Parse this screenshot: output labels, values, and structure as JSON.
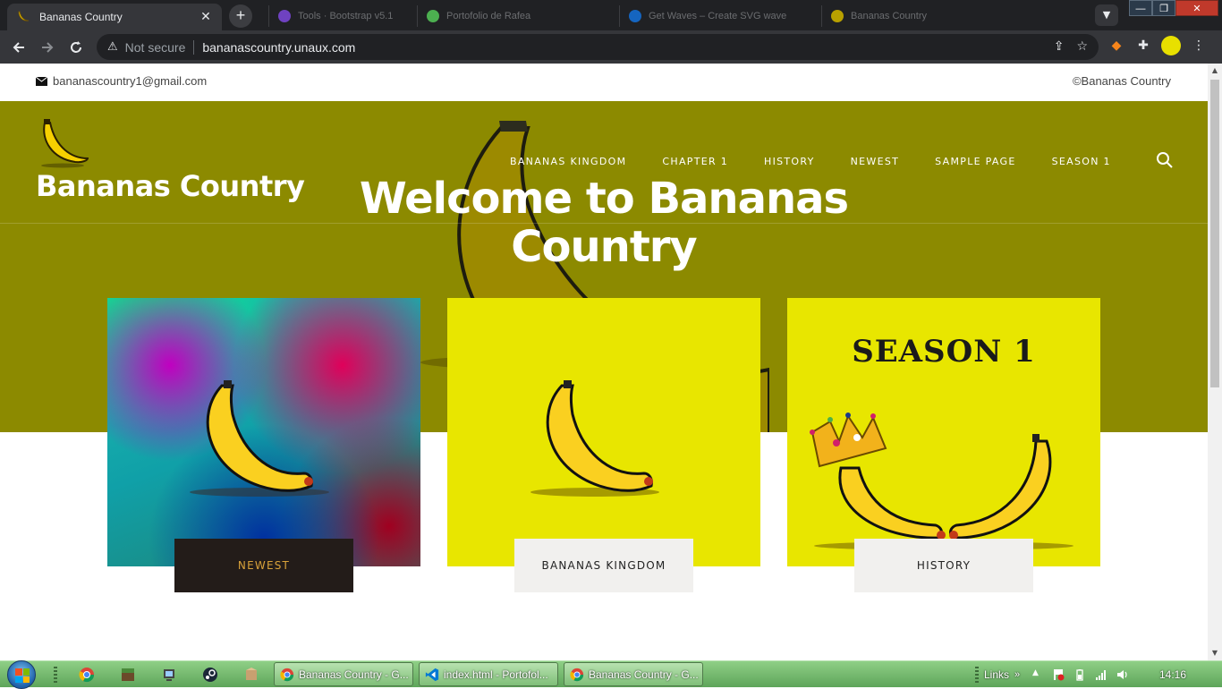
{
  "browser": {
    "active_tab_title": "Bananas Country",
    "background_tabs": [
      "Tools · Bootstrap v5.1",
      "Portofolio de Rafea",
      "Get Waves – Create SVG wave",
      "Bananas Country"
    ],
    "security_label": "Not secure",
    "url": "bananascountry.unaux.com"
  },
  "site": {
    "email": "bananascountry1@gmail.com",
    "copyright": "©Bananas Country",
    "title": "Bananas Country",
    "nav": [
      "BANANAS KINGDOM",
      "CHAPTER 1",
      "HISTORY",
      "NEWEST",
      "SAMPLE PAGE",
      "SEASON 1"
    ],
    "welcome": "Welcome to Bananas Country",
    "season_heading": "SEASON 1",
    "cards": [
      {
        "label": "NEWEST"
      },
      {
        "label": "BANANAS KINGDOM"
      },
      {
        "label": "HISTORY"
      }
    ]
  },
  "colors": {
    "hero_olive": "#8c8a00",
    "card_yellow": "#e8e600",
    "newest_label_bg": "#231c19",
    "newest_label_text": "#d9a23a"
  },
  "taskbar": {
    "tasks": [
      "Bananas Country - G...",
      "index.html - Portofol...",
      "Bananas Country - G..."
    ],
    "links_label": "Links",
    "time": "14:16"
  }
}
